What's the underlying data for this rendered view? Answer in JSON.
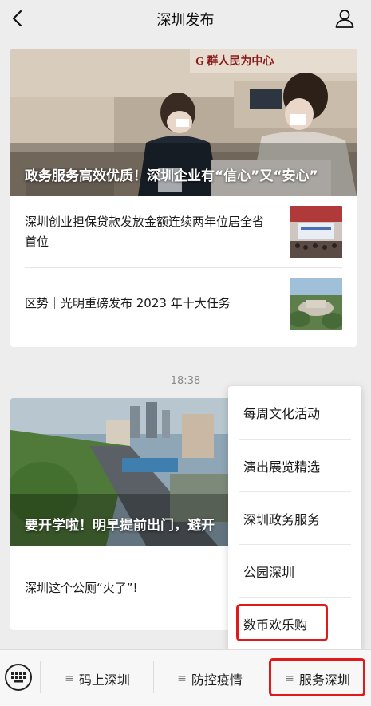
{
  "header": {
    "title": "深圳发布",
    "back_icon": "chevron-left-icon",
    "profile_icon": "person-icon"
  },
  "card1": {
    "hero_caption": "政务服务高效优质！深圳企业有“信心”又“安心”",
    "articles": [
      {
        "title": "深圳创业担保贷款发放金额连续两年位居全省首位"
      },
      {
        "title": "区势｜光明重磅发布 2023 年十大任务"
      }
    ]
  },
  "timestamp": "18:38",
  "card2": {
    "hero_caption": "要开学啦！明早提前出门，避开",
    "articles": [
      {
        "title": "深圳这个公厕“火了”!"
      }
    ]
  },
  "popup_menu": {
    "items": [
      {
        "label": "每周文化活动"
      },
      {
        "label": "演出展览精选"
      },
      {
        "label": "深圳政务服务"
      },
      {
        "label": "公园深圳"
      },
      {
        "label": "数币欢乐购"
      }
    ]
  },
  "bottom_bar": {
    "keyboard_icon": "keyboard-icon",
    "tabs": [
      {
        "label": "码上深圳"
      },
      {
        "label": "防控疫情"
      },
      {
        "label": "服务深圳"
      }
    ]
  },
  "colors": {
    "highlight": "#e0191b",
    "background": "#ededed"
  }
}
